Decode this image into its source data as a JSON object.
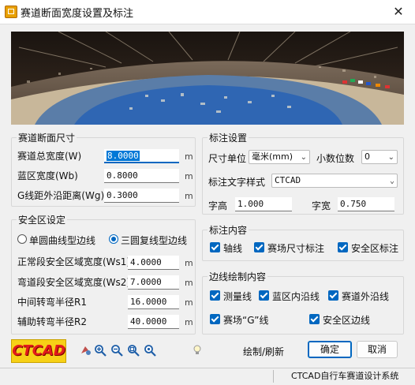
{
  "window": {
    "title": "赛道断面宽度设置及标注",
    "close_glyph": "✕"
  },
  "section": {
    "legend": "赛道断面尺寸",
    "fields": [
      {
        "label": "赛道总宽度(W)",
        "value": "8.0000",
        "unit": "m"
      },
      {
        "label": "蓝区宽度(Wb)",
        "value": "0.8000",
        "unit": "m"
      },
      {
        "label": "G线距外沿距离(Wg)",
        "value": "0.3000",
        "unit": "m"
      }
    ]
  },
  "safety": {
    "legend": "安全区设定",
    "radios": [
      {
        "label": "单圆曲线型边线",
        "checked": false
      },
      {
        "label": "三圆复线型边线",
        "checked": true
      }
    ],
    "fields": [
      {
        "label": "正常段安全区域宽度(Ws1)",
        "value": "4.0000",
        "unit": "m"
      },
      {
        "label": "弯道段安全区域宽度(Ws2)",
        "value": "7.0000",
        "unit": "m"
      },
      {
        "label": "中间转弯半径R1",
        "value": "16.0000",
        "unit": "m"
      },
      {
        "label": "辅助转弯半径R2",
        "value": "40.0000",
        "unit": "m"
      }
    ]
  },
  "annotation": {
    "legend": "标注设置",
    "unit_label": "尺寸单位",
    "unit_value": "毫米(mm)",
    "decimal_label": "小数位数",
    "decimal_value": "0",
    "style_label": "标注文字样式",
    "style_value": "CTCAD",
    "height_label": "字高",
    "height_value": "1.000",
    "width_label": "字宽",
    "width_value": "0.750"
  },
  "content": {
    "legend": "标注内容",
    "checks": [
      {
        "label": "轴线",
        "checked": true
      },
      {
        "label": "赛场尺寸标注",
        "checked": true
      },
      {
        "label": "安全区标注",
        "checked": true
      }
    ]
  },
  "edges": {
    "legend": "边线绘制内容",
    "checks": [
      {
        "label": "测量线",
        "checked": true
      },
      {
        "label": "蓝区内沿线",
        "checked": true
      },
      {
        "label": "赛道外沿线",
        "checked": true
      },
      {
        "label": "赛场“G”线",
        "checked": true
      },
      {
        "label": "安全区边线",
        "checked": true
      }
    ]
  },
  "toolbar": {
    "logo": "CTCAD",
    "tools": [
      "pan-icon",
      "zoom-in-icon",
      "zoom-out-icon",
      "zoom-window-icon",
      "zoom-extents-icon",
      "lightbulb-icon"
    ],
    "draw_label": "绘制/刷新",
    "ok_label": "确定",
    "cancel_label": "取消"
  },
  "status": {
    "text": "CTCAD自行车赛道设计系统"
  },
  "colors": {
    "accent": "#0067c0",
    "logo_text": "#e31b1b",
    "logo_bg": "#f7d117"
  }
}
